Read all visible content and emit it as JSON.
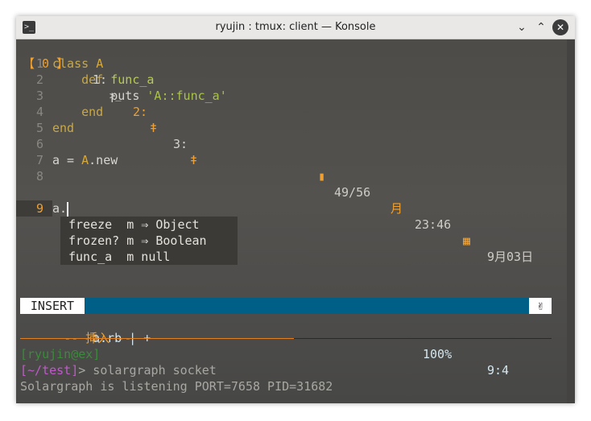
{
  "window": {
    "title": "ryujin : tmux: client — Konsole"
  },
  "colors": {
    "accent": "#f0a030",
    "statusline": "#005f87",
    "prompt_path": "#c05ac9",
    "prompt_user": "#3c8a3c"
  },
  "tmux": {
    "session": "【 0 】",
    "tabs": [
      "1:",
      "2:",
      "3:"
    ],
    "battery": "49/56",
    "moon": "月",
    "time": "23:46",
    "date": "9月03日"
  },
  "editor": {
    "lines": [
      {
        "no": "1"
      },
      {
        "no": "2"
      },
      {
        "no": "3"
      },
      {
        "no": "4"
      },
      {
        "no": "5"
      },
      {
        "no": "6"
      },
      {
        "no": "7"
      },
      {
        "no": "8"
      },
      {
        "no": "9"
      }
    ],
    "code": {
      "l1_kw": "class",
      "l1_name": "A",
      "l2_kw": "def",
      "l2_name": "func_a",
      "l3_call": "puts",
      "l3_str": "'A::func_a'",
      "l4_kw": "end",
      "l5_kw": "end",
      "l7_a": "a = ",
      "l7_cls": "A",
      "l7_rest": ".new",
      "l9_text": "a."
    },
    "completion": [
      {
        "text": "freeze  m ⇒ Object"
      },
      {
        "text": "frozen? m ⇒ Boolean"
      },
      {
        "text": "func_a  m null"
      }
    ]
  },
  "statusline": {
    "mode": "INSERT",
    "file": "a.rb | +",
    "percent": "100%",
    "position": "9:4",
    "mode_msg": "-- 挿入 --"
  },
  "shell": {
    "user": "[ryujin@ex]",
    "path": "[~/test]",
    "command": "> solargraph socket",
    "output": "Solargraph is listening PORT=7658 PID=31682"
  }
}
